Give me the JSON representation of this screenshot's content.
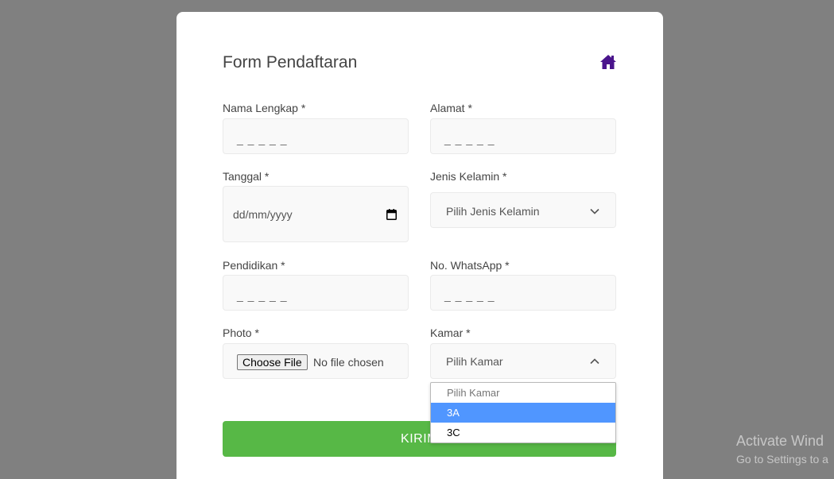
{
  "form": {
    "title": "Form Pendaftaran",
    "home_icon": "home-icon",
    "accent_color": "#4a148c"
  },
  "fields": {
    "nama": {
      "label": "Nama Lengkap *",
      "placeholder": "_ _ _ _ _"
    },
    "alamat": {
      "label": "Alamat *",
      "placeholder": "_ _ _ _ _"
    },
    "tanggal": {
      "label": "Tanggal *",
      "value": "dd/mm/yyyy",
      "icon": "calendar-icon"
    },
    "jenis_kelamin": {
      "label": "Jenis Kelamin *",
      "selected": "Pilih Jenis Kelamin"
    },
    "pendidikan": {
      "label": "Pendidikan *",
      "placeholder": "_ _ _ _ _"
    },
    "whatsapp": {
      "label": "No. WhatsApp *",
      "placeholder": "_ _ _ _ _"
    },
    "photo": {
      "label": "Photo *",
      "button": "Choose File",
      "status": "No file chosen"
    },
    "kamar": {
      "label": "Kamar *",
      "selected": "Pilih Kamar",
      "options": [
        "Pilih Kamar",
        "3A",
        "3C"
      ],
      "highlighted": "3A"
    }
  },
  "submit": {
    "label": "KIRIM",
    "color": "#57b846"
  },
  "watermark": {
    "line1": "Activate Wind",
    "line2": "Go to Settings to a"
  }
}
